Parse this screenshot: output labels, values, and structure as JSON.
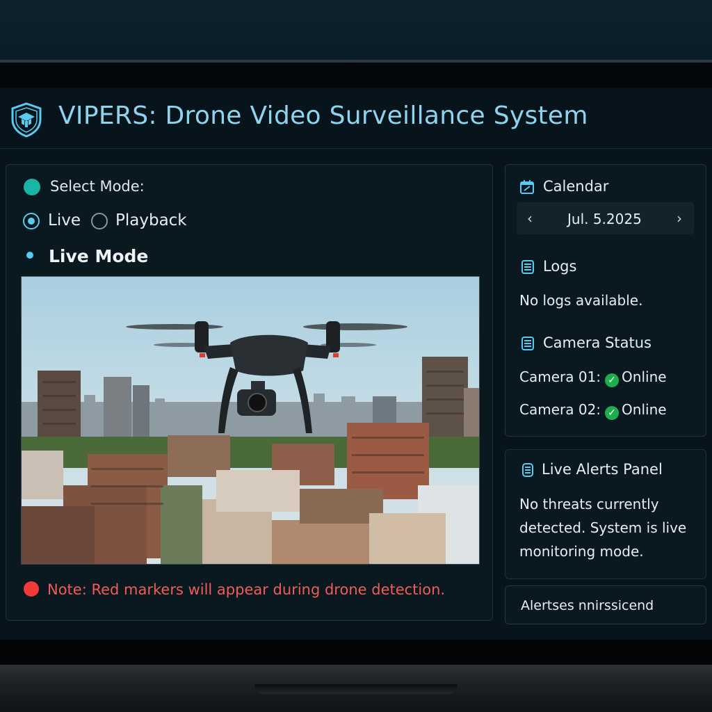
{
  "header": {
    "title": "VIPERS: Drone Video Surveillance System",
    "logo_icon": "shield-graduation-cap-icon"
  },
  "mode": {
    "select_label": "Select Mode:",
    "options": [
      {
        "label": "Live",
        "selected": true
      },
      {
        "label": "Playback",
        "selected": false
      }
    ],
    "current_heading": "Live Mode"
  },
  "video": {
    "description_icon": "drone-camera-feed"
  },
  "note": {
    "text": "Note: Red markers will appear during drone detection."
  },
  "calendar": {
    "title": "Calendar",
    "icon": "calendar-icon",
    "date": "Jul. 5.2025",
    "prev": "‹",
    "next": "›"
  },
  "logs": {
    "title": "Logs",
    "icon": "log-icon",
    "empty_text": "No logs available."
  },
  "camera_status": {
    "title": "Camera Status",
    "icon": "camera-status-icon",
    "cameras": [
      {
        "name": "Camera 01:",
        "status": "Online"
      },
      {
        "name": "Camera 02:",
        "status": "Online"
      }
    ]
  },
  "alerts": {
    "title": "Live Alerts Panel",
    "icon": "alert-list-icon",
    "message": "No threats currently detected. System is live monitoring mode.",
    "button_label": "Alertses nnirssicend"
  },
  "colors": {
    "accent": "#56ccf2",
    "title": "#8fd4ef",
    "online": "#1fae4f",
    "warning": "#f05d55"
  }
}
